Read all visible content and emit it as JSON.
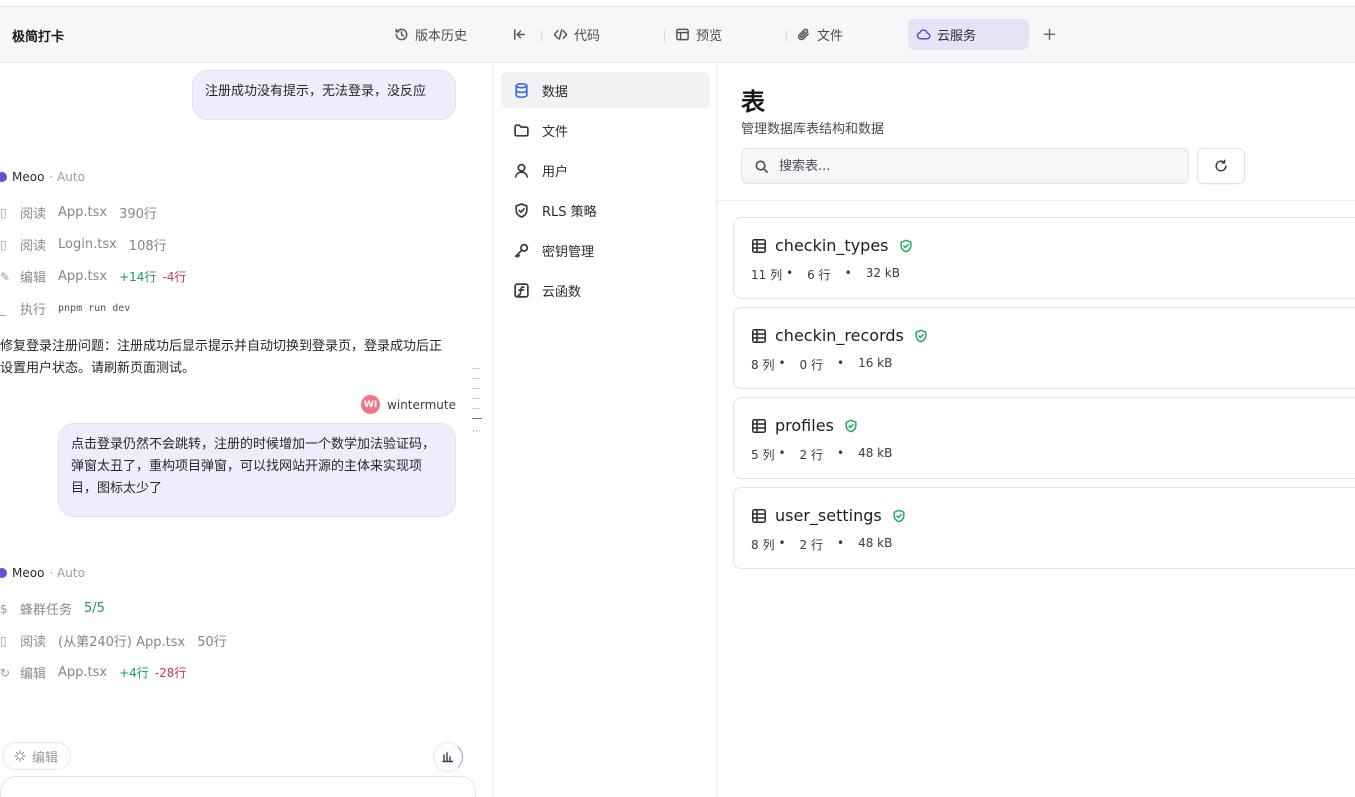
{
  "header": {
    "app_title": "极简打卡",
    "history": "版本历史",
    "code": "代码",
    "preview": "预览",
    "files": "文件",
    "cloud": "云服务",
    "plus": "+"
  },
  "chat": {
    "user_msg_1": "注册成功没有提示，无法登录，没反应",
    "assistant_name": "Meoo",
    "assistant_mode": "· Auto",
    "tools_1": [
      {
        "action": "阅读",
        "file": "App.tsx",
        "lines": "390行"
      },
      {
        "action": "阅读",
        "file": "Login.tsx",
        "lines": "108行"
      },
      {
        "action": "编辑",
        "file": "App.tsx",
        "add": "+14行",
        "del": "-4行"
      },
      {
        "action": "执行",
        "code": "pnpm run dev"
      }
    ],
    "summary": "已修复登录注册问题：注册成功后显示提示并自动切换到登录页，登录成功后正确设置用户状态。请刷新页面测试。",
    "user_initials": "WI",
    "user_name": "wintermute",
    "user_msg_2": "点击登录仍然不会跳转，注册的时候增加一个数学加法验证码，弹窗太丑了，重构项目弹窗，可以找网站开源的主体来实现项目，图标太少了",
    "assistant_name_2": "Meoo",
    "assistant_mode_2": "· Auto",
    "tools_2": [
      {
        "action": "蜂群任务",
        "count": "5/5"
      },
      {
        "action": "阅读",
        "file": "(从第240行)  App.tsx",
        "lines": "50行"
      },
      {
        "action": "编辑",
        "file": "App.tsx",
        "add": "+4行",
        "del": "-28行"
      }
    ],
    "edit_chip": "编辑"
  },
  "nav": {
    "items": [
      {
        "label": "数据",
        "icon": "database-icon"
      },
      {
        "label": "文件",
        "icon": "folder-icon"
      },
      {
        "label": "用户",
        "icon": "user-icon"
      },
      {
        "label": "RLS 策略",
        "icon": "shield-icon"
      },
      {
        "label": "密钥管理",
        "icon": "key-icon"
      },
      {
        "label": "云函数",
        "icon": "function-icon"
      }
    ]
  },
  "main": {
    "title": "表",
    "subtitle": "管理数据库表结构和数据",
    "search_placeholder": "搜索表...",
    "tables": [
      {
        "name": "checkin_types",
        "cols": "11 列",
        "rows": "6 行",
        "size": "32 kB"
      },
      {
        "name": "checkin_records",
        "cols": "8 列",
        "rows": "0 行",
        "size": "16 kB"
      },
      {
        "name": "profiles",
        "cols": "5 列",
        "rows": "2 行",
        "size": "48 kB"
      },
      {
        "name": "user_settings",
        "cols": "8 列",
        "rows": "2 行",
        "size": "48 kB"
      }
    ]
  },
  "colors": {
    "accent": "#5b4fd6",
    "active_nav_icon": "#3f6fe0",
    "rls_ok": "#22a85f",
    "added": "#1a9a5a",
    "removed": "#d2344e"
  }
}
